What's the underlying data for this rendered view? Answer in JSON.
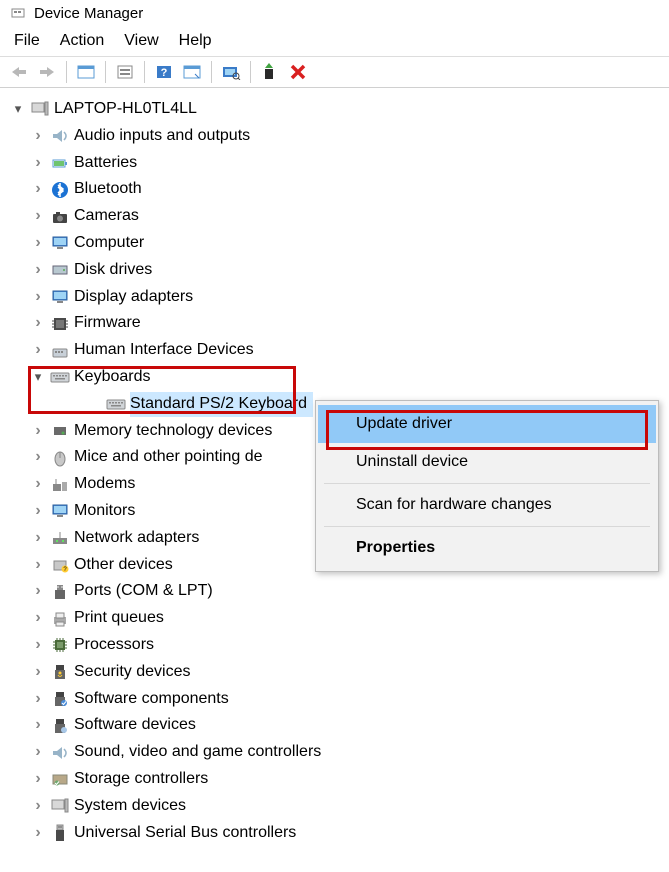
{
  "window": {
    "title": "Device Manager"
  },
  "menu": {
    "file": "File",
    "action": "Action",
    "view": "View",
    "help": "Help"
  },
  "root": {
    "name": "LAPTOP-HL0TL4LL"
  },
  "categories": [
    {
      "id": "audio",
      "label": "Audio inputs and outputs"
    },
    {
      "id": "batteries",
      "label": "Batteries"
    },
    {
      "id": "bluetooth",
      "label": "Bluetooth"
    },
    {
      "id": "cameras",
      "label": "Cameras"
    },
    {
      "id": "computer",
      "label": "Computer"
    },
    {
      "id": "diskdrives",
      "label": "Disk drives"
    },
    {
      "id": "display",
      "label": "Display adapters"
    },
    {
      "id": "firmware",
      "label": "Firmware"
    },
    {
      "id": "hid",
      "label": "Human Interface Devices"
    },
    {
      "id": "keyboards",
      "label": "Keyboards"
    },
    {
      "id": "memory",
      "label": "Memory technology devices"
    },
    {
      "id": "mice",
      "label": "Mice and other pointing de"
    },
    {
      "id": "modems",
      "label": "Modems"
    },
    {
      "id": "monitors",
      "label": "Monitors"
    },
    {
      "id": "network",
      "label": "Network adapters"
    },
    {
      "id": "other",
      "label": "Other devices"
    },
    {
      "id": "ports",
      "label": "Ports (COM & LPT)"
    },
    {
      "id": "printq",
      "label": "Print queues"
    },
    {
      "id": "processors",
      "label": "Processors"
    },
    {
      "id": "security",
      "label": "Security devices"
    },
    {
      "id": "swcomp",
      "label": "Software components"
    },
    {
      "id": "swdev",
      "label": "Software devices"
    },
    {
      "id": "sound",
      "label": "Sound, video and game controllers"
    },
    {
      "id": "storage",
      "label": "Storage controllers"
    },
    {
      "id": "system",
      "label": "System devices"
    },
    {
      "id": "usb",
      "label": "Universal Serial Bus controllers"
    }
  ],
  "keyboards_child": {
    "label": "Standard PS/2 Keyboard"
  },
  "context_menu": {
    "update": "Update driver",
    "uninstall": "Uninstall device",
    "scan": "Scan for hardware changes",
    "properties": "Properties"
  }
}
